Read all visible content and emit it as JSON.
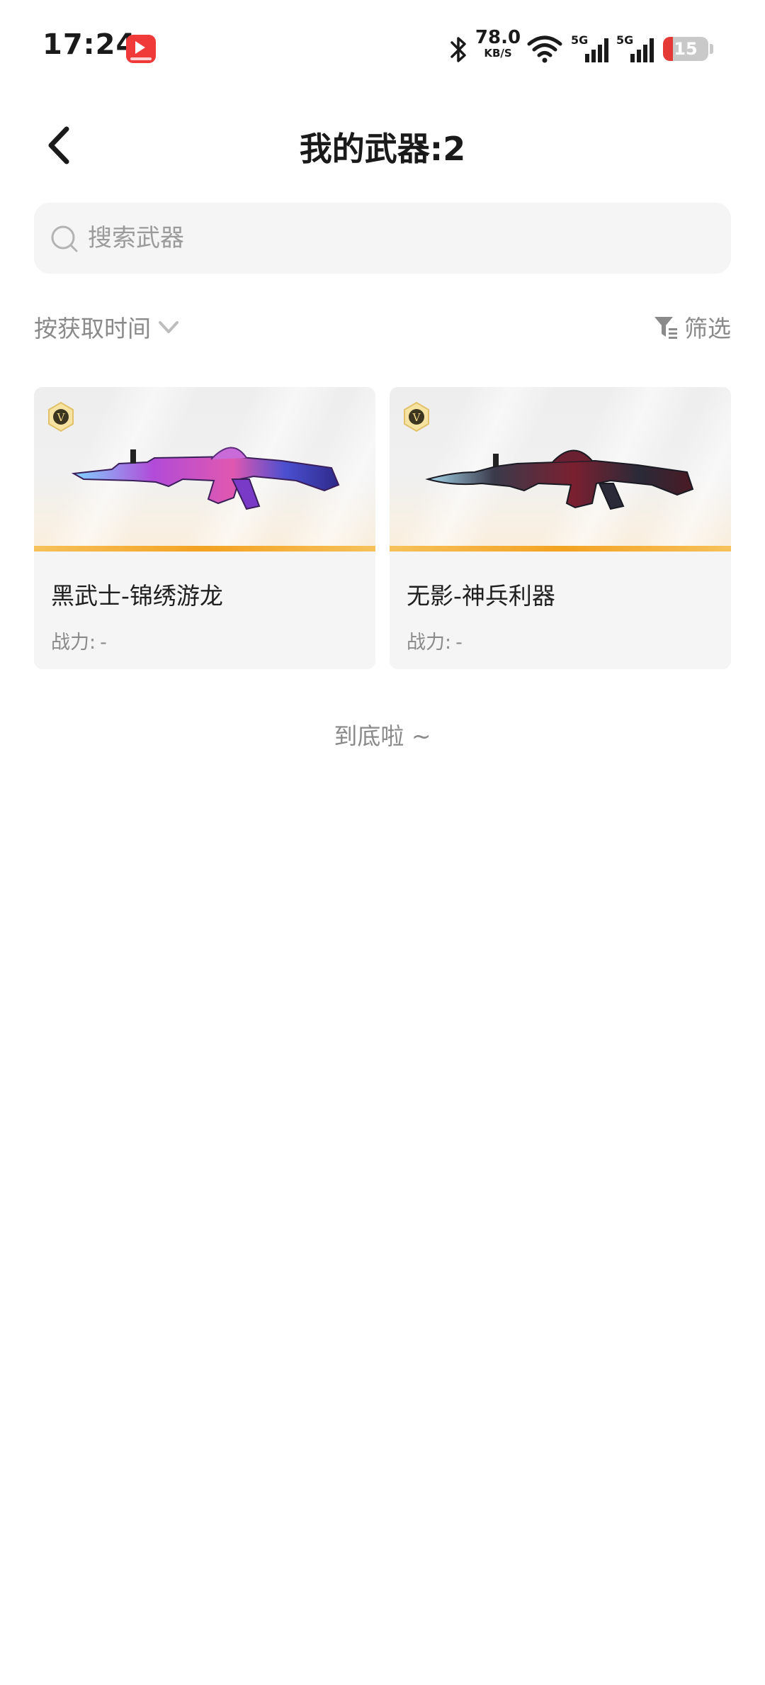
{
  "status_bar": {
    "time": "17:24",
    "net_speed_value": "78.0",
    "net_speed_unit": "KB/S",
    "signal_1_label": "5G",
    "signal_2_label": "5G",
    "battery_level": "15",
    "icons": [
      "app-badge-icon",
      "bluetooth-icon",
      "wifi-icon",
      "signal-icon",
      "battery-icon"
    ]
  },
  "header": {
    "title": "我的武器:2",
    "back_icon": "chevron-left-icon"
  },
  "search": {
    "placeholder": "搜索武器",
    "value": ""
  },
  "toolbar": {
    "sort_label": "按获取时间",
    "filter_label": "筛选"
  },
  "weapons": [
    {
      "name": "黑武士-锦绣游龙",
      "power_label": "战力:",
      "power_value": "-",
      "badge": "V"
    },
    {
      "name": "无影-神兵利器",
      "power_label": "战力:",
      "power_value": "-",
      "badge": "V"
    }
  ],
  "footer": {
    "end_text": "到底啦 ~"
  },
  "colors": {
    "accent_bar": "#f3a221",
    "battery_low": "#e53935",
    "muted_text": "#8a8a8a"
  }
}
